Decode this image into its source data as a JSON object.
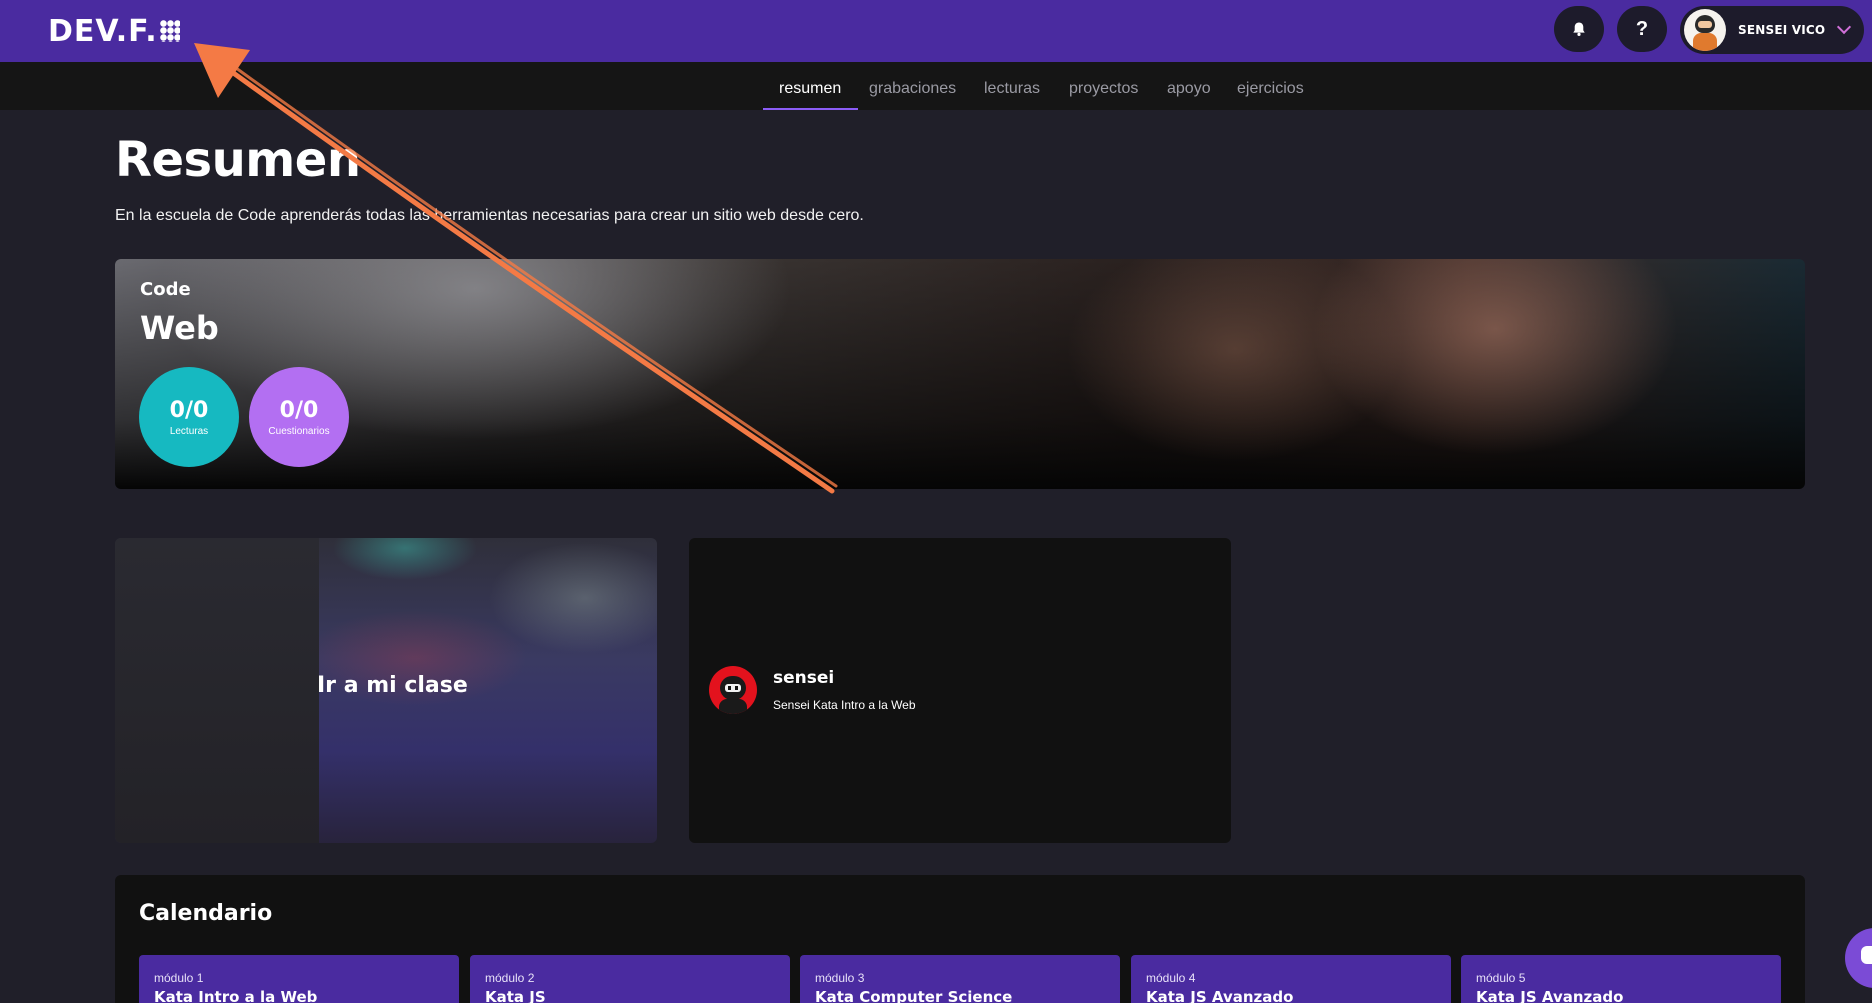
{
  "header": {
    "logo": "DEV.F.",
    "help_label": "?",
    "user_name": "SENSEI VICO"
  },
  "tabs": [
    {
      "label": "resumen",
      "active": true
    },
    {
      "label": "grabaciones"
    },
    {
      "label": "lecturas"
    },
    {
      "label": "proyectos"
    },
    {
      "label": "apoyo"
    },
    {
      "label": "ejercicios"
    }
  ],
  "page": {
    "title": "Resumen",
    "description": "En la escuela de Code aprenderás todas las herramientas necesarias para crear un sitio web desde cero."
  },
  "hero": {
    "school": "Code",
    "track": "Web",
    "stats": [
      {
        "value": "0/0",
        "label": "Lecturas",
        "color": "#16b9c1"
      },
      {
        "value": "0/0",
        "label": "Cuestionarios",
        "color": "#b36ff2"
      }
    ]
  },
  "class_card": {
    "label": "Ir a mi clase"
  },
  "sensei_card": {
    "name": "sensei",
    "role": "Sensei Kata Intro a la Web"
  },
  "calendar": {
    "title": "Calendario",
    "modules": [
      {
        "number": "módulo 1",
        "name": "Kata Intro a la Web"
      },
      {
        "number": "módulo 2",
        "name": "Kata JS"
      },
      {
        "number": "módulo 3",
        "name": "Kata Computer Science"
      },
      {
        "number": "módulo 4",
        "name": "Kata JS Avanzado"
      },
      {
        "number": "módulo 5",
        "name": "Kata JS Avanzado"
      }
    ]
  },
  "colors": {
    "brand": "#4a2ba0",
    "accent": "#8b5cf6",
    "annotation_arrow": "#f47a45"
  },
  "icons": [
    "bell-icon",
    "help-icon",
    "chevron-down-icon",
    "chat-icon"
  ]
}
